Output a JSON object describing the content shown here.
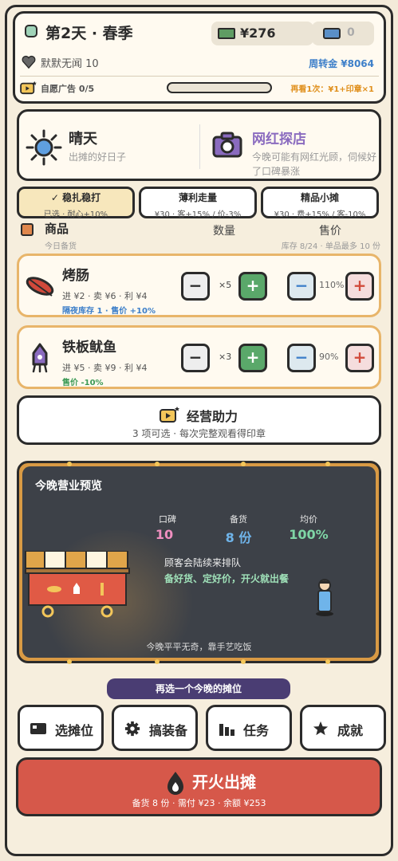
{
  "header": {
    "day": "第2天 · 春季",
    "cash": "¥276",
    "tickets": "0",
    "reputation": "默默无闻 10",
    "weekly_fund": "周转金 ¥8064",
    "ads": "自愿广告 0/5",
    "ad_hint": "再看1次：¥1+印章×1",
    "ad_progress": 0
  },
  "weather": {
    "title": "晴天",
    "subtitle": "出摊的好日子"
  },
  "event": {
    "title": "网红探店",
    "desc": "今晚可能有网红光顾，伺候好了口碑暴涨"
  },
  "strategies": [
    {
      "title": "✓ 稳扎稳打",
      "desc": "已选 · 耐心+10%",
      "selected": true
    },
    {
      "title": "薄利走量",
      "desc": "¥30 · 客+15% / 价-3%",
      "selected": false
    },
    {
      "title": "精品小摊",
      "desc": "¥30 · 费+15% / 客-10%",
      "selected": false
    }
  ],
  "goods": {
    "title": "商品",
    "subtitle": "今日备货",
    "col_qty": "数量",
    "col_price": "售价",
    "stock_info": "库存 8/24 · 单品最多 10 份",
    "items": [
      {
        "name": "烤肠",
        "econ": "进 ¥2 · 卖 ¥6 · 利 ¥4",
        "note": "隔夜库存 1 · 售价 +10%",
        "qty": "×5",
        "price_pct": "110%",
        "icon": "sausage-icon"
      },
      {
        "name": "铁板鱿鱼",
        "econ": "进 ¥5 · 卖 ¥9 · 利 ¥4",
        "note": "售价 -10%",
        "qty": "×3",
        "price_pct": "90%",
        "icon": "squid-icon"
      }
    ],
    "minus": "−",
    "plus": "+"
  },
  "boost": {
    "title": "经营助力",
    "subtitle": "3 项可选 · 每次完整观看得印章"
  },
  "preview": {
    "title": "今晚营业预览",
    "stats": [
      {
        "label": "口碑",
        "value": "10",
        "color": "#f08fc0"
      },
      {
        "label": "备货",
        "value": "8 份",
        "color": "#6fb4ea"
      },
      {
        "label": "均价",
        "value": "100%",
        "color": "#7fd6a6"
      }
    ],
    "msg1": "顾客会陆续来排队",
    "msg2": "备好货、定好价，开火就出餐",
    "footer": "今晚平平无奇，靠手艺吃饭"
  },
  "change_location": "再选一个今晚的摊位",
  "nav": [
    {
      "label": "选摊位",
      "icon": "stall-icon"
    },
    {
      "label": "搞装备",
      "icon": "gear-icon"
    },
    {
      "label": "任务",
      "icon": "tasks-icon"
    },
    {
      "label": "成就",
      "icon": "star-icon"
    }
  ],
  "start": {
    "title": "开火出摊",
    "subtitle": "备货 8 份 · 需付 ¥23 · 余额 ¥253"
  }
}
